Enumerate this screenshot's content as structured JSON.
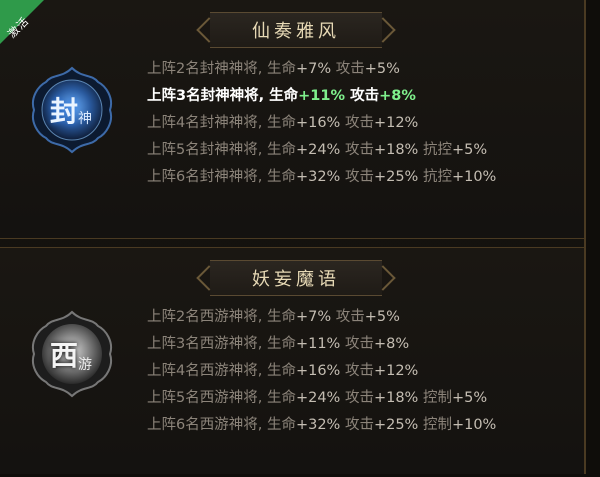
{
  "colors": {
    "accent_green": "#7ff08c",
    "active_tag": "#2f9a4a",
    "title": "#e7d9b5"
  },
  "top": {
    "tag": "激活",
    "title": "仙奏雅风",
    "badge": {
      "main": "封",
      "sub": "神",
      "icon": "fengshen-emblem-icon"
    },
    "lines": [
      {
        "text": "上阵2名封神神将, 生命",
        "v1": "+7%",
        "t2": " 攻击",
        "v2": "+5%",
        "t3": "",
        "v3": "",
        "active": false
      },
      {
        "text": "上阵3名封神神将, 生命",
        "v1": "+11%",
        "t2": " 攻击",
        "v2": "+8%",
        "t3": "",
        "v3": "",
        "active": true
      },
      {
        "text": "上阵4名封神神将, 生命",
        "v1": "+16%",
        "t2": " 攻击",
        "v2": "+12%",
        "t3": "",
        "v3": "",
        "active": false
      },
      {
        "text": "上阵5名封神神将, 生命",
        "v1": "+24%",
        "t2": " 攻击",
        "v2": "+18%",
        "t3": " 抗控",
        "v3": "+5%",
        "active": false
      },
      {
        "text": "上阵6名封神神将, 生命",
        "v1": "+32%",
        "t2": " 攻击",
        "v2": "+25%",
        "t3": " 抗控",
        "v3": "+10%",
        "active": false
      }
    ]
  },
  "bottom": {
    "title": "妖妄魔语",
    "badge": {
      "main": "西",
      "sub": "游",
      "icon": "xiyou-emblem-icon"
    },
    "lines": [
      {
        "text": "上阵2名西游神将, 生命",
        "v1": "+7%",
        "t2": " 攻击",
        "v2": "+5%",
        "t3": "",
        "v3": "",
        "active": false
      },
      {
        "text": "上阵3名西游神将, 生命",
        "v1": "+11%",
        "t2": " 攻击",
        "v2": "+8%",
        "t3": "",
        "v3": "",
        "active": false
      },
      {
        "text": "上阵4名西游神将, 生命",
        "v1": "+16%",
        "t2": " 攻击",
        "v2": "+12%",
        "t3": "",
        "v3": "",
        "active": false
      },
      {
        "text": "上阵5名西游神将, 生命",
        "v1": "+24%",
        "t2": " 攻击",
        "v2": "+18%",
        "t3": " 控制",
        "v3": "+5%",
        "active": false
      },
      {
        "text": "上阵6名西游神将, 生命",
        "v1": "+32%",
        "t2": " 攻击",
        "v2": "+25%",
        "t3": " 控制",
        "v3": "+10%",
        "active": false
      }
    ]
  }
}
